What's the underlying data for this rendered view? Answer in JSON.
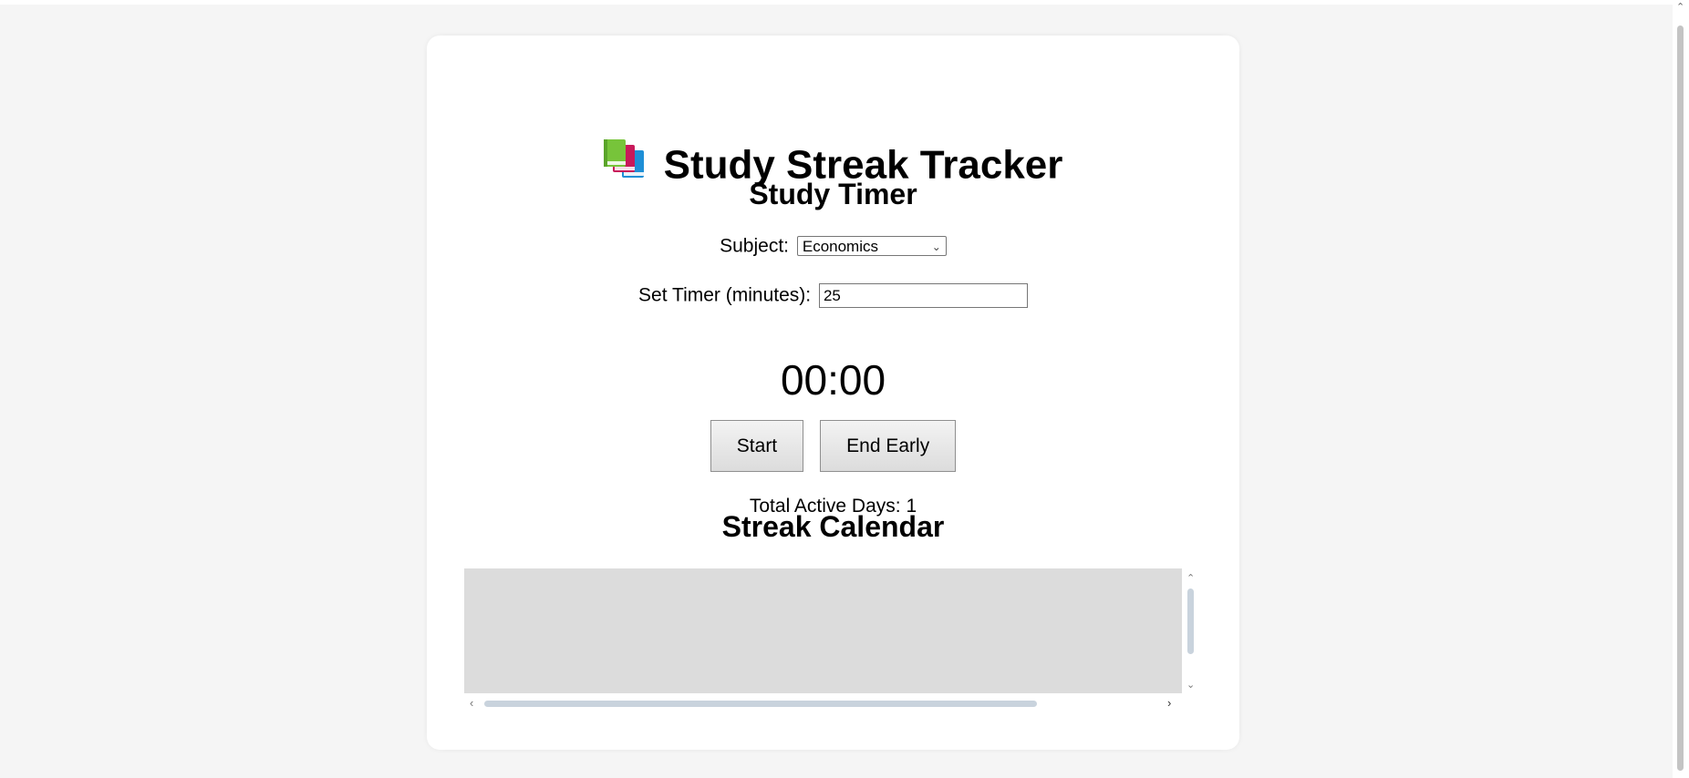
{
  "app": {
    "title": "Study Streak Tracker",
    "title_icon": "books-icon"
  },
  "timer_section": {
    "heading": "Study Timer",
    "subject_label": "Subject:",
    "subject_selected": "Economics",
    "minutes_label": "Set Timer (minutes):",
    "minutes_value": "25",
    "countdown": "00:00",
    "start_label": "Start",
    "end_early_label": "End Early",
    "active_days_text": "Total Active Days: 1"
  },
  "calendar_section": {
    "heading": "Streak Calendar"
  },
  "colors": {
    "page_background": "#f5f5f5",
    "card_background": "#ffffff",
    "calendar_background": "#dcdcdc",
    "scrollbar_thumb": "#c9d3dd"
  }
}
